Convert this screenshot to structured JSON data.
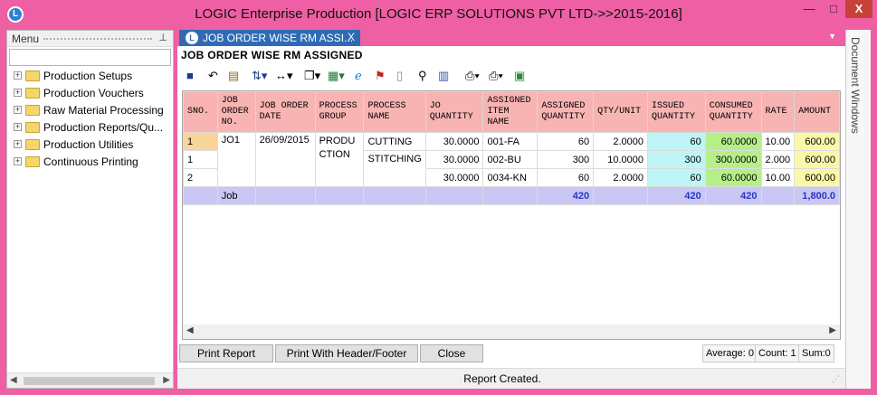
{
  "window": {
    "title": "LOGIC Enterprise Production  [LOGIC ERP SOLUTIONS PVT LTD->>2015-2016]",
    "app_icon": "L",
    "minimize_glyph": "—",
    "maximize_glyph": "□",
    "close_glyph": "X"
  },
  "menu": {
    "header": "Menu",
    "pin_glyph": "⊥",
    "items": [
      {
        "label": "Production Setups"
      },
      {
        "label": "Production Vouchers"
      },
      {
        "label": "Raw Material Processing"
      },
      {
        "label": "Production  Reports/Qu..."
      },
      {
        "label": "Production Utilities"
      },
      {
        "label": "Continuous Printing"
      }
    ],
    "expand_glyph": "+"
  },
  "side_panel": {
    "label": "Document Windows"
  },
  "tab": {
    "label": "JOB ORDER WISE RM ASSI...",
    "close_glyph": "X",
    "icon": "L"
  },
  "report": {
    "title": "JOB ORDER WISE RM ASSIGNED"
  },
  "toolbar": {
    "icons": [
      "save-icon",
      "undo-icon",
      "print-preview-icon",
      "sort-icon",
      "column-width-icon",
      "copy-icon",
      "excel-icon",
      "ie-icon",
      "pdf-icon",
      "blank-page-icon",
      "find-icon",
      "chart-icon",
      "preview-icon",
      "printer-icon",
      "export-icon"
    ]
  },
  "table": {
    "headers": {
      "sno": "SNO.",
      "job_order_no": "JOB ORDER NO.",
      "job_order_date": "JOB ORDER DATE",
      "process_group": "PROCESS GROUP",
      "process_name": "PROCESS NAME",
      "jo_quantity": "JO QUANTITY",
      "assigned_item_name": "ASSIGNED ITEM NAME",
      "assigned_quantity": "ASSIGNED QUANTITY",
      "qty_unit": "QTY/UNIT",
      "issued_quantity": "ISSUED QUANTITY",
      "consumed_quantity": "CONSUMED QUANTITY",
      "rate": "RATE",
      "amount": "AMOUNT"
    },
    "group": {
      "job_order_no": "JO1",
      "job_order_date": "26/09/2015",
      "process_group": "PRODUCTION"
    },
    "process_names": [
      "CUTTING",
      "STITCHING"
    ],
    "rows": [
      {
        "sno": "1",
        "jo_quantity": "30.0000",
        "item": "001-FA",
        "assigned": "60",
        "qty_unit": "2.0000",
        "issued": "60",
        "consumed": "60.0000",
        "rate": "10.00",
        "amount": "600.00"
      },
      {
        "sno": "1",
        "jo_quantity": "30.0000",
        "item": "002-BU",
        "assigned": "300",
        "qty_unit": "10.0000",
        "issued": "300",
        "consumed": "300.0000",
        "rate": "2.000",
        "amount": "600.00"
      },
      {
        "sno": "2",
        "jo_quantity": "30.0000",
        "item": "0034-KN",
        "assigned": "60",
        "qty_unit": "2.0000",
        "issued": "60",
        "consumed": "60.0000",
        "rate": "10.00",
        "amount": "600.00"
      }
    ],
    "summary": {
      "label": "Job",
      "assigned": "420",
      "issued": "420",
      "consumed": "420",
      "amount": "1,800.0"
    }
  },
  "buttons": {
    "print_report": "Print Report",
    "print_header_footer": "Print With Header/Footer",
    "close": "Close"
  },
  "stats": {
    "average": "Average: 0",
    "count": "Count: 1",
    "sum": "Sum:0"
  },
  "status": {
    "text": "Report Created."
  }
}
